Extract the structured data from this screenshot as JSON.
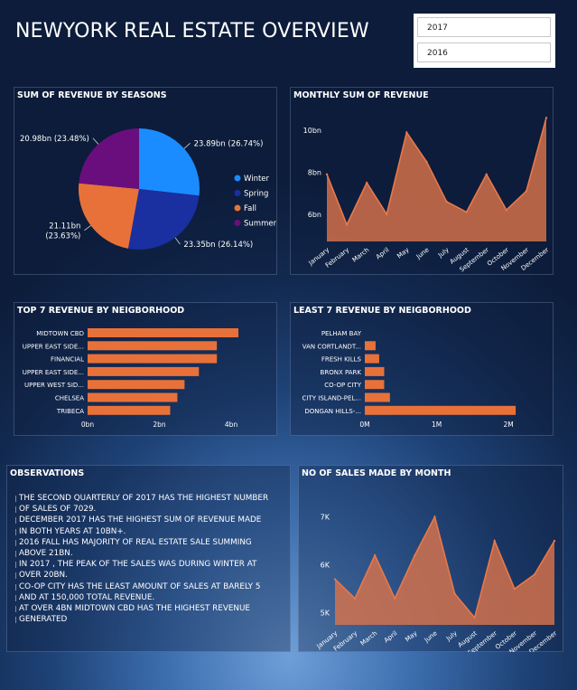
{
  "dashboard": {
    "title": "NEWYORK REAL ESTATE OVERVIEW"
  },
  "slicer": {
    "items": [
      "2017",
      "2016"
    ]
  },
  "observations": {
    "title": "OBSERVATIONS",
    "lines": [
      "THE SECOND QUARTERLY OF 2017 HAS THE HIGHEST NUMBER",
      "OF SALES OF 7029.",
      "DECEMBER 2017 HAS THE HIGHEST SUM OF REVENUE MADE",
      "IN BOTH YEARS AT 10BN+.",
      " 2016  FALL HAS MAJORITY OF REAL ESTATE SALE SUMMING",
      "ABOVE 21BN.",
      " IN 2017 , THE PEAK OF THE SALES WAS DURING WINTER AT",
      "OVER 20BN.",
      "  CO-OP CITY HAS THE LEAST AMOUNT OF SALES AT BARELY 5",
      "AND AT 150,000 TOTAL REVENUE.",
      "AT OVER 4BN MIDTOWN CBD HAS THE HIGHEST REVENUE",
      "GENERATED"
    ]
  },
  "colors": {
    "winter": "#1a8cff",
    "spring": "#1a2fa0",
    "fall": "#e8713a",
    "summer": "#6a0e7e",
    "bar": "#e8713a",
    "area": "#d9734b"
  },
  "chart_data": [
    {
      "id": "pie",
      "type": "pie",
      "title": "SUM OF REVENUE BY SEASONS",
      "legend_position": "right",
      "slices": [
        {
          "name": "Winter",
          "value": 23.89,
          "label": "23.89bn (26.74%)"
        },
        {
          "name": "Spring",
          "value": 23.35,
          "label": "23.35bn (26.14%)"
        },
        {
          "name": "Fall",
          "value": 21.11,
          "label_lines": [
            "21.11bn",
            "(23.63%)"
          ]
        },
        {
          "name": "Summer",
          "value": 20.98,
          "label": "20.98bn (23.48%)"
        }
      ]
    },
    {
      "id": "monthly-revenue",
      "type": "area",
      "title": "MONTHLY SUM OF REVENUE",
      "categories": [
        "January",
        "February",
        "March",
        "April",
        "May",
        "June",
        "July",
        "August",
        "September",
        "October",
        "November",
        "December"
      ],
      "values": [
        7.9,
        5.5,
        7.5,
        6.0,
        9.9,
        8.5,
        6.6,
        6.1,
        7.9,
        6.2,
        7.1,
        10.6
      ],
      "ylim": [
        4.7,
        11.0
      ],
      "ytick_values": [
        6,
        8,
        10
      ],
      "ytick_labels": [
        "6bn",
        "8bn",
        "10bn"
      ]
    },
    {
      "id": "top-neighborhood",
      "type": "bar",
      "orientation": "horizontal",
      "title": "TOP 7 REVENUE BY NEIGBORHOOD",
      "categories": [
        "MIDTOWN CBD",
        "UPPER EAST SIDE...",
        "FINANCIAL",
        "UPPER EAST SIDE...",
        "UPPER WEST SID...",
        "CHELSEA",
        "TRIBECA"
      ],
      "values": [
        4.2,
        3.6,
        3.6,
        3.1,
        2.7,
        2.5,
        2.3
      ],
      "xlim": [
        0,
        4.3
      ],
      "xtick_values": [
        0,
        2,
        4
      ],
      "xtick_labels": [
        "0bn",
        "2bn",
        "4bn"
      ]
    },
    {
      "id": "least-neighborhood",
      "type": "bar",
      "orientation": "horizontal",
      "title": "LEAST 7 REVENUE BY NEIGBORHOOD",
      "categories": [
        "PELHAM BAY",
        "VAN CORTLANDT...",
        "FRESH KILLS",
        "BRONX PARK",
        "CO-OP CITY",
        "CITY ISLAND-PEL...",
        "DONGAN HILLS-..."
      ],
      "values": [
        0,
        0.15,
        0.2,
        0.27,
        0.27,
        0.35,
        2.1
      ],
      "xlim": [
        0,
        2.3
      ],
      "xtick_values": [
        0,
        1,
        2
      ],
      "xtick_labels": [
        "0M",
        "1M",
        "2M"
      ]
    },
    {
      "id": "sales-by-month",
      "type": "area",
      "title": "NO OF SALES MADE BY MONTH",
      "categories": [
        "January",
        "February",
        "March",
        "April",
        "May",
        "June",
        "July",
        "August",
        "September",
        "October",
        "November",
        "December"
      ],
      "values": [
        5.7,
        5.3,
        6.2,
        5.3,
        6.2,
        7.0,
        5.4,
        4.9,
        6.5,
        5.5,
        5.8,
        6.5
      ],
      "ylim": [
        4.75,
        7.35
      ],
      "ytick_values": [
        5,
        6,
        7
      ],
      "ytick_labels": [
        "5K",
        "6K",
        "7K"
      ]
    }
  ]
}
